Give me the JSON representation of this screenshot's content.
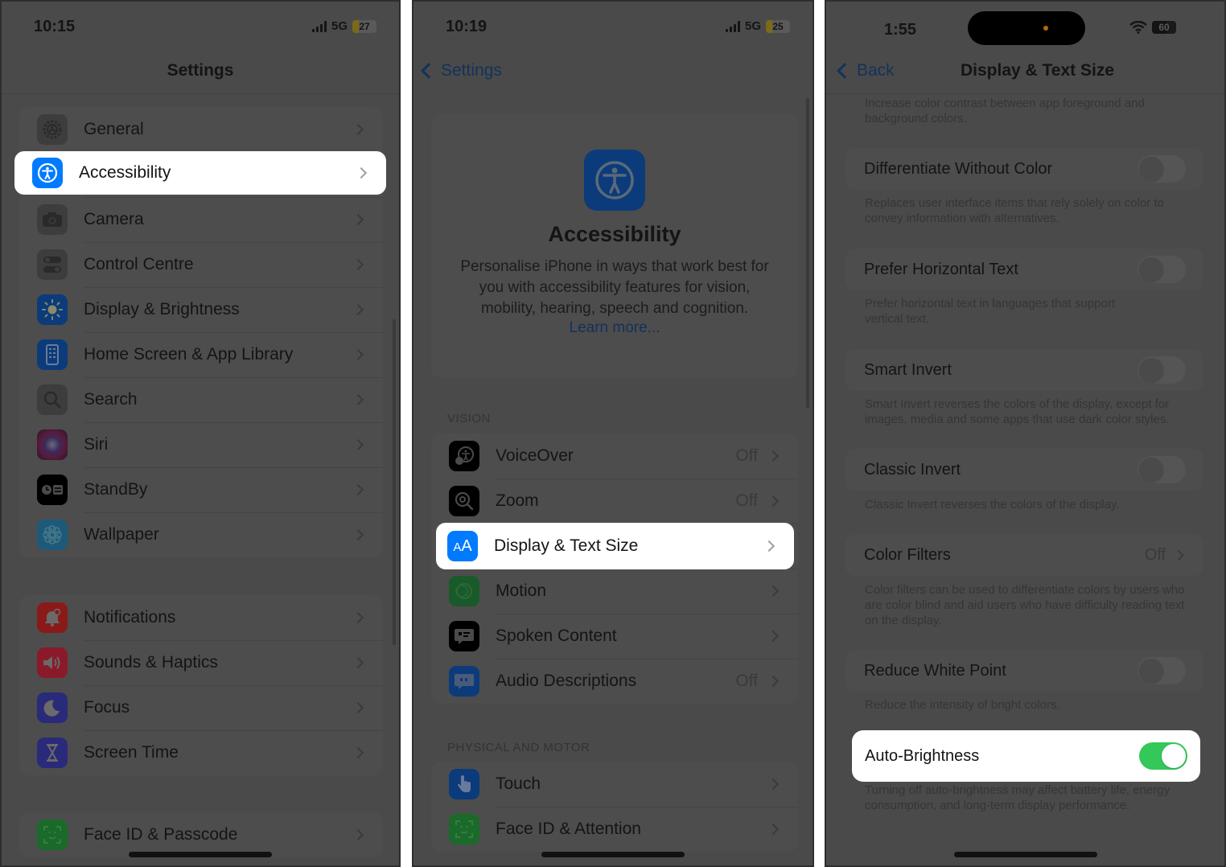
{
  "colors": {
    "dim_background": "#4a4a4a",
    "highlight": "#ffffff",
    "accent_blue": "#007aff",
    "toggle_on": "#34c759",
    "battery_low": "#ffcc00"
  },
  "phone1": {
    "status": {
      "time": "10:15",
      "network": "5G",
      "battery": "27"
    },
    "title": "Settings",
    "groups": [
      {
        "items": [
          {
            "label": "General",
            "icon": "gear-icon",
            "color": "#3d3d3d"
          },
          {
            "label": "Accessibility",
            "icon": "accessibility-icon",
            "color": "#007aff",
            "highlighted": true
          },
          {
            "label": "Camera",
            "icon": "camera-icon",
            "color": "#3d3d3d"
          },
          {
            "label": "Control Centre",
            "icon": "toggles-icon",
            "color": "#3d3d3d"
          },
          {
            "label": "Display & Brightness",
            "icon": "sun-icon",
            "color": "#0b3b7a"
          },
          {
            "label": "Home Screen & App Library",
            "icon": "phone-grid-icon",
            "color": "#0b3b7a"
          },
          {
            "label": "Search",
            "icon": "search-icon",
            "color": "#3d3d3d"
          },
          {
            "label": "Siri",
            "icon": "siri-icon",
            "color": "#2a1a2a"
          },
          {
            "label": "StandBy",
            "icon": "standby-icon",
            "color": "#000000"
          },
          {
            "label": "Wallpaper",
            "icon": "flower-icon",
            "color": "#1d5a7a"
          }
        ]
      },
      {
        "items": [
          {
            "label": "Notifications",
            "icon": "bell-icon",
            "color": "#8a1a1a"
          },
          {
            "label": "Sounds & Haptics",
            "icon": "speaker-icon",
            "color": "#8a1a2a"
          },
          {
            "label": "Focus",
            "icon": "moon-icon",
            "color": "#2a2a7a"
          },
          {
            "label": "Screen Time",
            "icon": "hourglass-icon",
            "color": "#2a2a7a"
          }
        ]
      },
      {
        "items": [
          {
            "label": "Face ID & Passcode",
            "icon": "faceid-icon",
            "color": "#1a6a2a"
          }
        ]
      }
    ]
  },
  "phone2": {
    "status": {
      "time": "10:19",
      "network": "5G",
      "battery": "25"
    },
    "back_label": "Settings",
    "hero": {
      "title": "Accessibility",
      "description": "Personalise iPhone in ways that work best for you with accessibility features for vision, mobility, hearing, speech and cognition.",
      "link": "Learn more..."
    },
    "sections": [
      {
        "header": "VISION",
        "items": [
          {
            "label": "VoiceOver",
            "value": "Off",
            "icon": "voiceover-icon",
            "color": "#000000"
          },
          {
            "label": "Zoom",
            "value": "Off",
            "icon": "zoom-icon",
            "color": "#000000"
          },
          {
            "label": "Display & Text Size",
            "value": "",
            "icon": "text-size-icon",
            "color": "#007aff",
            "highlighted": true
          },
          {
            "label": "Motion",
            "value": "",
            "icon": "motion-icon",
            "color": "#1a5a2a"
          },
          {
            "label": "Spoken Content",
            "value": "",
            "icon": "speech-bubble-icon",
            "color": "#000000"
          },
          {
            "label": "Audio Descriptions",
            "value": "Off",
            "icon": "quote-bubble-icon",
            "color": "#0b3b7a"
          }
        ]
      },
      {
        "header": "PHYSICAL AND MOTOR",
        "items": [
          {
            "label": "Touch",
            "value": "",
            "icon": "hand-icon",
            "color": "#0b3b7a"
          },
          {
            "label": "Face ID & Attention",
            "value": "",
            "icon": "faceid-icon",
            "color": "#1a6a2a"
          }
        ]
      }
    ]
  },
  "phone3": {
    "status": {
      "time": "1:55",
      "battery": "60"
    },
    "back_label": "Back",
    "title": "Display & Text Size",
    "top_footnote": "Increase color contrast between app foreground and background colors.",
    "settings": [
      {
        "label": "Differentiate Without Color",
        "type": "toggle",
        "on": false,
        "footnote": "Replaces user interface items that rely solely on color to convey information with alternatives."
      },
      {
        "label": "Prefer Horizontal Text",
        "type": "toggle",
        "on": false,
        "footnote": "Prefer horizontal text in languages that support vertical text."
      },
      {
        "label": "Smart Invert",
        "type": "toggle",
        "on": false,
        "footnote": "Smart Invert reverses the colors of the display, except for images, media and some apps that use dark color styles."
      },
      {
        "label": "Classic Invert",
        "type": "toggle",
        "on": false,
        "footnote": "Classic Invert reverses the colors of the display."
      },
      {
        "label": "Color Filters",
        "type": "link",
        "value": "Off",
        "footnote": "Color filters can be used to differentiate colors by users who are color blind and aid users who have difficulty reading text on the display."
      },
      {
        "label": "Reduce White Point",
        "type": "toggle",
        "on": false,
        "footnote": "Reduce the intensity of bright colors."
      },
      {
        "label": "Auto-Brightness",
        "type": "toggle",
        "on": true,
        "highlighted": true,
        "footnote": "Turning off auto-brightness may affect battery life, energy consumption, and long-term display performance."
      }
    ]
  }
}
